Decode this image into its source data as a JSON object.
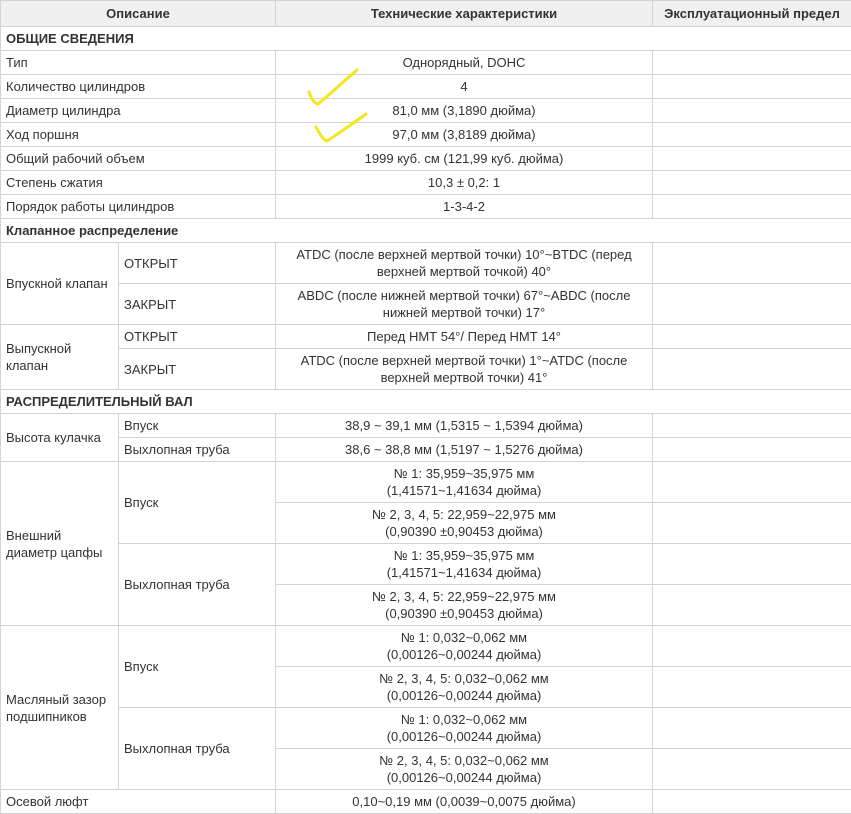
{
  "header": {
    "description": "Описание",
    "specs": "Технические характеристики",
    "limit": "Эксплуатационный предел"
  },
  "general": {
    "section_title": "ОБЩИЕ СВЕДЕНИЯ",
    "rows": [
      {
        "label": "Тип",
        "value": "Однорядный, DOHC"
      },
      {
        "label": "Количество цилиндров",
        "value": "4"
      },
      {
        "label": "Диаметр цилиндра",
        "value": "81,0 мм (3,1890 дюйма)"
      },
      {
        "label": "Ход поршня",
        "value": "97,0 мм (3,8189 дюйма)"
      },
      {
        "label": "Общий рабочий объем",
        "value": "1999 куб. см (121,99 куб. дюйма)"
      },
      {
        "label": "Степень сжатия",
        "value": "10,3 ± 0,2: 1"
      },
      {
        "label": "Порядок работы цилиндров",
        "value": "1-3-4-2"
      }
    ]
  },
  "valve_timing": {
    "section_title": "Клапанное распределение",
    "intake": {
      "label": "Впускной клапан",
      "open_label": "ОТКРЫТ",
      "open_value": "ATDC (после верхней мертвой точки) 10°~BTDC (перед верхней мертвой точкой) 40°",
      "close_label": "ЗАКРЫТ",
      "close_value": "ABDC (после нижней мертвой точки) 67°~ABDC (после нижней мертвой точки) 17°"
    },
    "exhaust": {
      "label": "Выпускной клапан",
      "open_label": "ОТКРЫТ",
      "open_value": "Перед НМТ 54°/ Перед НМТ 14°",
      "close_label": "ЗАКРЫТ",
      "close_value": "ATDC (после верхней мертвой точки) 1°~ATDC (после верхней мертвой точки) 41°"
    }
  },
  "camshaft": {
    "section_title": "РАСПРЕДЕЛИТЕЛЬНЫЙ ВАЛ",
    "cam_height": {
      "label": "Высота кулачка",
      "intake_label": "Впуск",
      "intake_value": "38,9 ~ 39,1 мм (1,5315 ~ 1,5394 дюйма)",
      "exhaust_label": "Выхлопная труба",
      "exhaust_value": "38,6 ~ 38,8 мм (1,5197 ~ 1,5276 дюйма)"
    },
    "journal_od": {
      "label": "Внешний диаметр цапфы",
      "intake_label": "Впуск",
      "intake_no1_line1": "№ 1: 35,959~35,975 мм",
      "intake_no1_line2": "(1,41571~1,41634 дюйма)",
      "intake_no2_line1": "№ 2, 3, 4, 5: 22,959~22,975 мм",
      "intake_no2_line2": "(0,90390 ±0,90453 дюйма)",
      "exhaust_label": "Выхлопная труба",
      "exhaust_no1_line1": "№ 1: 35,959~35,975 мм",
      "exhaust_no1_line2": "(1,41571~1,41634 дюйма)",
      "exhaust_no2_line1": "№ 2, 3, 4, 5: 22,959~22,975 мм",
      "exhaust_no2_line2": "(0,90390 ±0,90453 дюйма)"
    },
    "oil_clearance": {
      "label": "Масляный зазор подшипников",
      "intake_label": "Впуск",
      "intake_no1_line1": "№ 1: 0,032~0,062 мм",
      "intake_no1_line2": "(0,00126~0,00244 дюйма)",
      "intake_no2_line1": "№ 2, 3, 4, 5: 0,032~0,062 мм",
      "intake_no2_line2": "(0,00126~0,00244 дюйма)",
      "exhaust_label": "Выхлопная труба",
      "exhaust_no1_line1": "№ 1: 0,032~0,062 мм",
      "exhaust_no1_line2": "(0,00126~0,00244 дюйма)",
      "exhaust_no2_line1": "№ 2, 3, 4, 5: 0,032~0,062 мм",
      "exhaust_no2_line2": "(0,00126~0,00244 дюйма)"
    },
    "end_play": {
      "label": "Осевой люфт",
      "value": "0,10~0,19 мм (0,0039~0,0075 дюйма)"
    }
  },
  "annotations": {
    "checkmark_color": "#f5e61e"
  }
}
